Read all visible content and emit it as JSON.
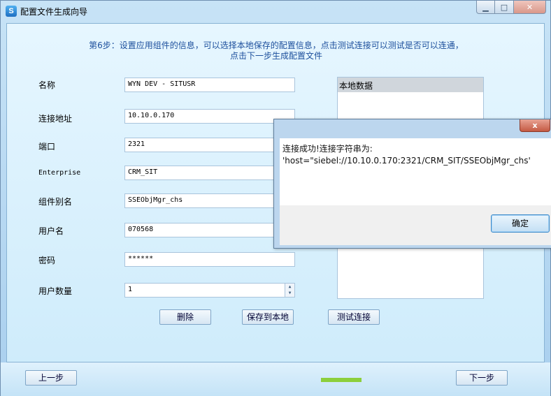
{
  "window": {
    "title": "配置文件生成向导",
    "app_icon": "S",
    "icon_semantic": "app-logo-icon"
  },
  "step": {
    "line1": "第6步：设置应用组件的信息，可以选择本地保存的配置信息，点击测试连接可以测试是否可以连通，",
    "line2": "点击下一步生成配置文件"
  },
  "form": {
    "name_label": "名称",
    "name_value": "WYN DEV - SITUSR",
    "address_label": "连接地址",
    "address_value": "10.10.0.170",
    "port_label": "端口",
    "port_value": "2321",
    "enterprise_label": "Enterprise",
    "enterprise_value": "CRM_SIT",
    "alias_label": "组件别名",
    "alias_value": "SSEObjMgr_chs",
    "user_label": "用户名",
    "user_value": "070568",
    "password_label": "密码",
    "password_value": "******",
    "count_label": "用户数量",
    "count_value": "1"
  },
  "local_panel": {
    "header": "本地数据"
  },
  "buttons": {
    "delete": "删除",
    "save_local": "保存到本地",
    "test_conn": "测试连接",
    "prev": "上一步",
    "next": "下一步"
  },
  "progress": {
    "fraction": 0.1
  },
  "dialog": {
    "close": "x",
    "line1": "连接成功!连接字符串为:",
    "line2": "'host=\"siebel://10.10.0.170:2321/CRM_SIT/SSEObjMgr_chs'",
    "ok": "确定"
  },
  "colors": {
    "accent": "#1c4f9c",
    "progress": "#8ccf3c"
  }
}
